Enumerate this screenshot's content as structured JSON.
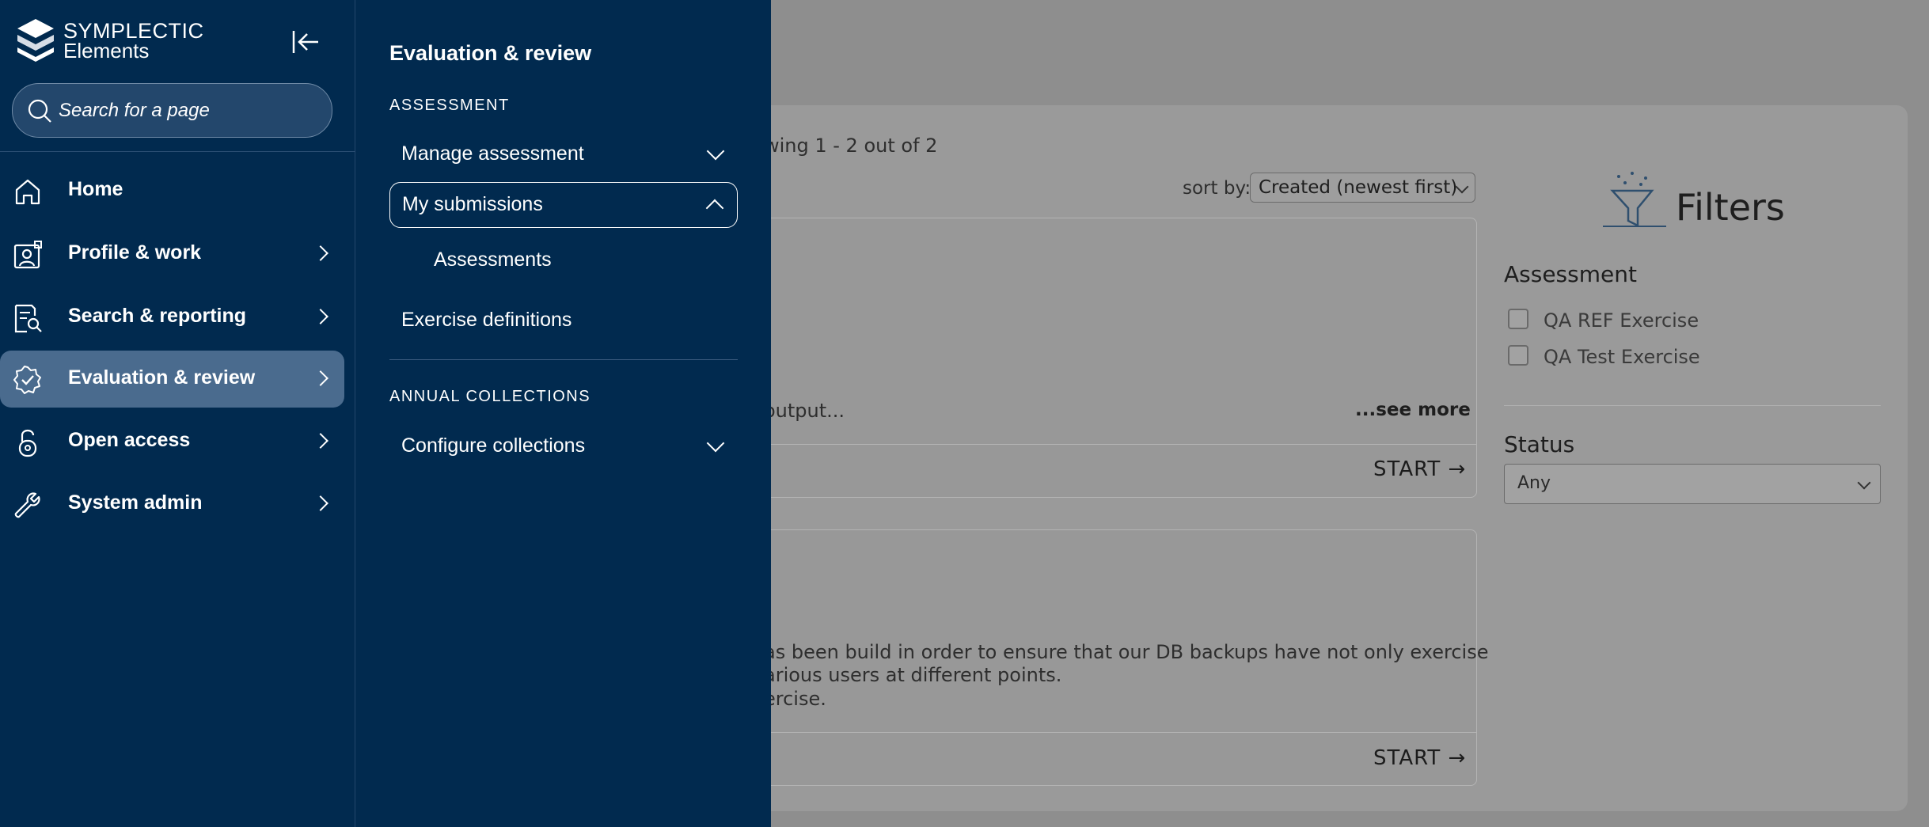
{
  "app": {
    "logo_line1": "SYMPLECTIC",
    "logo_line2": "Elements"
  },
  "search": {
    "placeholder": "Search for a page"
  },
  "nav": {
    "items": [
      {
        "label": "Home",
        "icon": "home-icon",
        "has_submenu": false
      },
      {
        "label": "Profile & work",
        "icon": "profile-icon",
        "has_submenu": true
      },
      {
        "label": "Search & reporting",
        "icon": "report-search-icon",
        "has_submenu": true
      },
      {
        "label": "Evaluation & review",
        "icon": "badge-check-icon",
        "has_submenu": true,
        "active": true
      },
      {
        "label": "Open access",
        "icon": "lock-open-icon",
        "has_submenu": true
      },
      {
        "label": "System admin",
        "icon": "wrench-icon",
        "has_submenu": true
      }
    ]
  },
  "submenu": {
    "title": "Evaluation & review",
    "section1": "ASSESSMENT",
    "manage_assessment": "Manage assessment",
    "my_submissions": "My submissions",
    "assessments": "Assessments",
    "exercise_definitions": "Exercise definitions",
    "section2": "ANNUAL COLLECTIONS",
    "configure_collections": "Configure collections"
  },
  "background": {
    "showing": "wing 1 - 2 out of 2",
    "sort_label": "sort by:",
    "sort_value": "Created (newest first)",
    "card1": {
      "snippet": "output...",
      "see_more": "...see more",
      "start": "START →"
    },
    "card2": {
      "line1": "as been build in order to ensure that our DB backups have not only exercise",
      "line2": "arious users at different points.",
      "line3": "ercise.",
      "start": "START →"
    },
    "filters": {
      "title": "Filters",
      "assessment_heading": "Assessment",
      "options": [
        "QA REF Exercise",
        "QA Test Exercise"
      ],
      "status_heading": "Status",
      "status_value": "Any"
    }
  },
  "colors": {
    "nav_bg": "#012a4f",
    "active_item_bg": "#4a6b8e",
    "overlay_bg": "#8e8e8e"
  }
}
